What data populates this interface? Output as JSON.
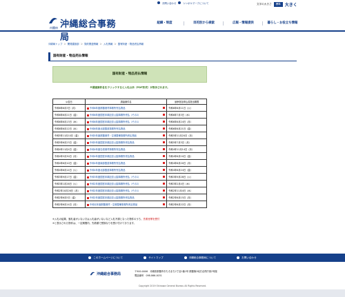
{
  "util": {
    "inquiry": "お問い合わせ",
    "symbol": "シンボルマークについて",
    "font_label": "文字の大きさ",
    "font_standard": "標準",
    "font_large": "大きく"
  },
  "logo": {
    "name": "沖縄総合事務局",
    "sub": "内閣府"
  },
  "gnav": [
    "組織・制度",
    "目的別から検索",
    "広報・情報提供",
    "暮らし・お役立ち情報"
  ],
  "breadcrumb": [
    "沖縄局トップ",
    "開発建設部",
    "契約関連情報",
    "入札情報",
    "国有財産・物品売払情報"
  ],
  "page_title": "国有財産・物品売払情報",
  "banner": "国有財産・物品売払情報",
  "note": "※調達案件名をクリックすると入札公示（PDF形式）が表示されます。",
  "table": {
    "headers": [
      "公告日",
      "調達案件名",
      "競争参加申込書提出期限"
    ],
    "rows": [
      [
        "令和6年6月3日（月）",
        "令和6年度那覇港湾事務所売払物品",
        "令和6年6月11日（火）"
      ],
      [
        "令和6年6月21日（金）",
        "令和6年度国営沖縄記念公園事務所売払（その2）",
        "令和6年7月3日（水）"
      ],
      [
        "令和6年6月13日（木）",
        "令和6年度国営沖縄記念公園事務所売払（その1）",
        "令和6年6月24日（月）"
      ],
      [
        "令和6年6月12日（水）",
        "令和6年度北部国道事務所売払物品",
        "令和6年6月21日（金）"
      ],
      [
        "令和5年11月10日（金）",
        "令和5年度那覇港湾・空港整備事務所売払物品",
        "令和5年11月20日（月）"
      ],
      [
        "令和5年6月23日（金）",
        "令和5年度国営沖縄記念公園事務所売払物品",
        "令和5年7月3日（月）"
      ],
      [
        "令和4年11月4日（金）",
        "令和4年度石垣港湾事務所売払物品",
        "令和4年11月14日（月）"
      ],
      [
        "令和4年5月30日（月）",
        "令和4年度国営沖縄記念公園事務所売払物品",
        "令和4年6月10日（金）"
      ],
      [
        "令和4年6月10日（金）",
        "令和4年度南部国道事務所売払物品",
        "令和4年6月20日（月）"
      ],
      [
        "令和4年6月14日（火）",
        "令和4年度北部国道事務所売払物品",
        "令和4年6月24日（金）"
      ],
      [
        "令和3年9月17日（金）",
        "令和3年度国営沖縄記念公園事務所売払（その1）",
        "令和3年9月28日（火）"
      ],
      [
        "令和3年1月26日（火）",
        "令和2年度国営沖縄記念公園事務所売払（その2）",
        "令和3年2月4日（木）"
      ],
      [
        "令和2年10月26日（月）",
        "令和2年度国営沖縄記念公園事務所売払（その1）",
        "令和2年11月4日（水）"
      ],
      [
        "令和2年6月5日（金）",
        "令和2年度国営沖縄記念公園事務所売払物品",
        "令和2年6月15日（月）"
      ],
      [
        "令和2年6月14日（月）",
        "令和元年度那覇港湾・空港整備事務所売払物品",
        "令和2年6月22日（月）"
      ]
    ]
  },
  "footnote": {
    "text1": "※入札の結果、落札者がいない又は入札者がいないなど入札不調となった物件のうち、",
    "red": "先着世帯を受付",
    "text2": "※と表示された物件は、一定期間内、先着順で受検なりを受け付けております。"
  },
  "footnav": [
    "このホームページについて",
    "サイトマップ",
    "沖縄総合事務局について",
    "お問い合わせ"
  ],
  "footer": {
    "name": "沖縄総合事務局",
    "address": "〒900-0006　沖縄県那覇市おもろまち2丁目1番1号 那覇第2地方合同庁舎2号館",
    "tel": "電話番号　098-866-0031",
    "copyright": "Copyright 2019 Okinawa General Bureau All Rights Reserved."
  },
  "colors": {
    "brand": "#16408a",
    "banner": "#cfe3b8",
    "note": "#3b7a1f",
    "link": "#1a55aa"
  }
}
